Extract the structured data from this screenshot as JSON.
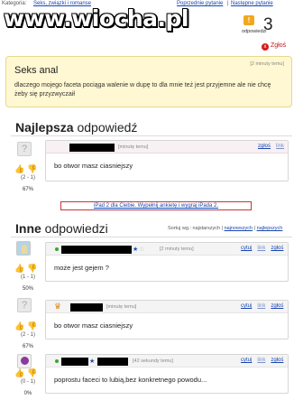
{
  "topbar": {
    "category_label": "Kategoria:",
    "category_value": "Seks, związki i romanse",
    "prev_link": "Poprzednie pytanie",
    "separator": "|",
    "next_link": "Następne pytanie"
  },
  "watermark": "www.wiocha.pl",
  "answers_count": {
    "badge": "!",
    "number": "3",
    "label": "odpowiedzi"
  },
  "report": {
    "icon": "x",
    "label": "Zgłoś"
  },
  "question": {
    "time": "[2 minuty temu]",
    "title": "Seks anal",
    "body": "dlaczego mojego faceta pociąga walenie w dupę to dla mnie też jest przyjemne ale nie chcę żeby się przyzwyczaił"
  },
  "best_section": {
    "title_bold": "Najlepsza",
    "title_rest": " odpowiedź"
  },
  "best_answer": {
    "time": "[minutę temu]",
    "report": "zgłoś",
    "link": "link",
    "body": "bo otwor masz ciasniejszy",
    "score": "(2 - 1)",
    "percent": "67%"
  },
  "promo": {
    "text": "iPad 2 dla Ciebie. Wypełnij ankietę i wygraj iPada 2."
  },
  "others_section": {
    "title_bold": "Inne",
    "title_rest": " odpowiedzi"
  },
  "sort": {
    "label": "Sortuj wg.: najstarszych",
    "sep1": "|",
    "newest": "najnowszych",
    "sep2": "|",
    "best": "najlepszych"
  },
  "answers": [
    {
      "time": "[2 minuty temu]",
      "cite": "cytuj",
      "link": "link",
      "report": "zgłoś",
      "body": "może jest gejem ?",
      "score": "(1 - 1)",
      "percent": "50%"
    },
    {
      "time": "[minutę temu]",
      "cite": "cytuj",
      "link": "link",
      "report": "zgłoś",
      "body": "bo otwor masz ciasniejszy",
      "score": "(2 - 1)",
      "percent": "67%"
    },
    {
      "time": "[42 sekundy temu]",
      "cite": "cytuj",
      "link": "link",
      "report": "zgłoś",
      "body": "poprostu faceci to lubią,bez konkretnego powodu...",
      "score": "(0 - 1)",
      "percent": "0%"
    }
  ],
  "colors": {
    "link": "#1a46b0",
    "question_bg": "#fff8d2",
    "promo_border": "#c83636",
    "report_red": "#c01818"
  }
}
